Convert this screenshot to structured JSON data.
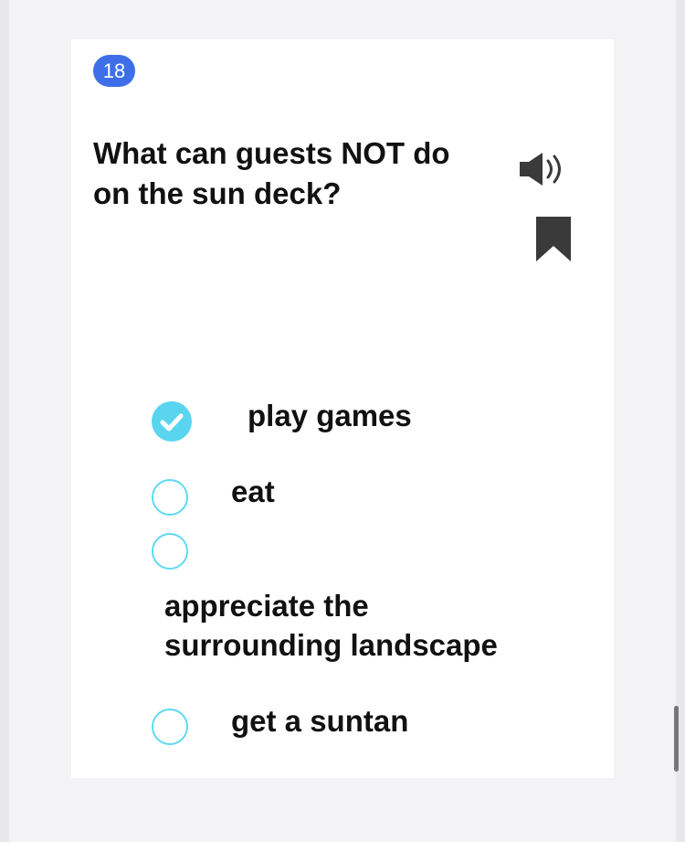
{
  "question": {
    "number": "18",
    "text": "What can guests NOT do on the sun deck?"
  },
  "icons": {
    "audio": "speaker-icon",
    "bookmark": "bookmark-icon",
    "check": "check-icon"
  },
  "options": [
    {
      "label": "play games",
      "selected": true
    },
    {
      "label": "eat",
      "selected": false
    },
    {
      "label": "appreciate the surrounding landscape",
      "selected": false
    },
    {
      "label": "get a suntan",
      "selected": false
    }
  ],
  "colors": {
    "badge": "#3e6fe8",
    "radio_accent": "#5ad5ef",
    "icon_dark": "#3a3a3a"
  }
}
